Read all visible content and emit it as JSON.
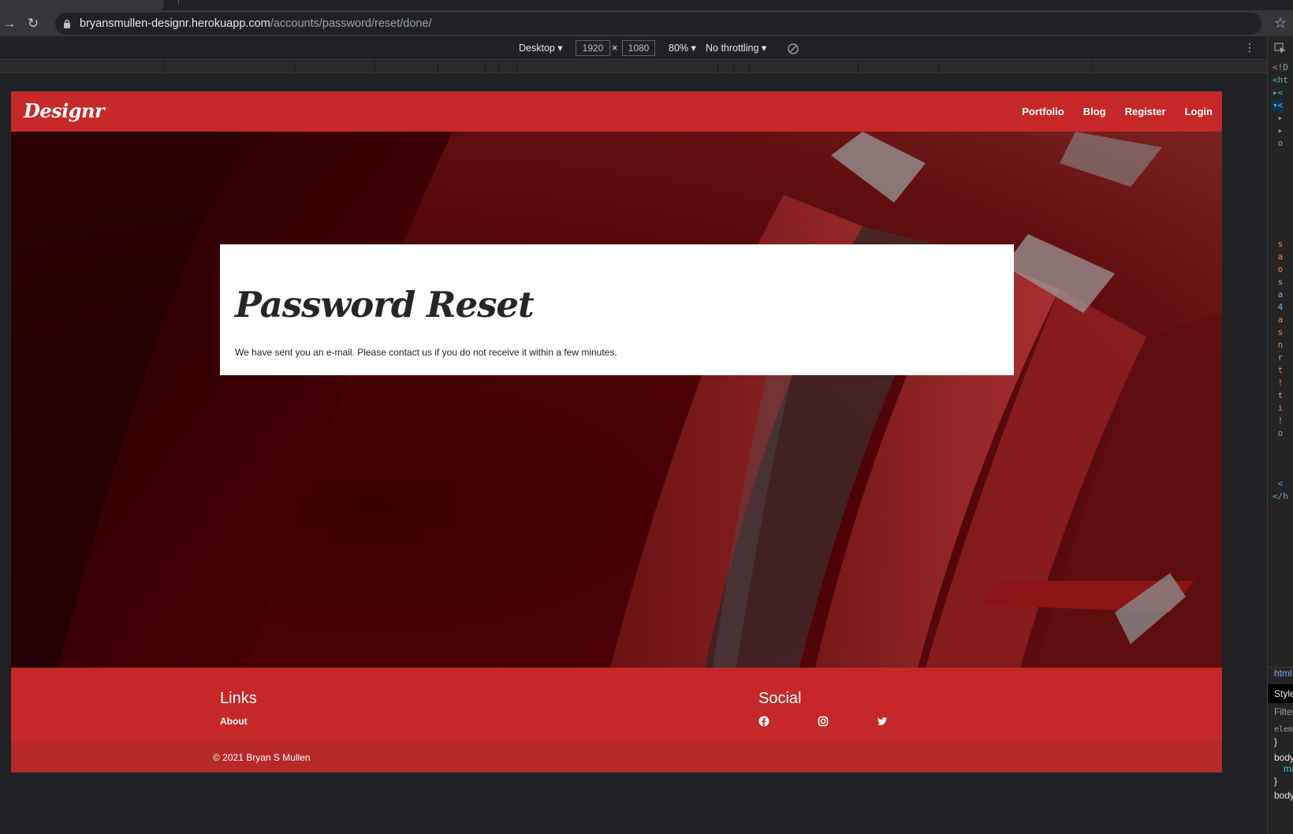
{
  "browser": {
    "url_host": "bryansmullen-designr.herokuapp.com",
    "url_path": "/accounts/password/reset/done/"
  },
  "device_toolbar": {
    "device": "Desktop",
    "width": "1920",
    "times": "×",
    "height": "1080",
    "zoom": "80%",
    "throttling": "No throttling"
  },
  "devtools": {
    "panel_tabs": [
      "html",
      "Style",
      "Filter",
      "eleme",
      "}",
      "body",
      "ma",
      "}",
      "body"
    ]
  },
  "page": {
    "brand": "Designr",
    "nav": [
      "Portfolio",
      "Blog",
      "Register",
      "Login"
    ],
    "card": {
      "title": "Password Reset",
      "message": "We have sent you an e-mail. Please contact us if you do not receive it within a few minutes."
    },
    "footer": {
      "links_heading": "Links",
      "links": [
        "About"
      ],
      "social_heading": "Social",
      "social_icons": [
        "facebook-icon",
        "instagram-icon",
        "twitter-icon"
      ],
      "copyright": "© 2021 Bryan S Mullen"
    }
  },
  "colors": {
    "brand_red": "#c62828",
    "copyright_red": "#b72828",
    "chrome_dark": "#202124"
  }
}
